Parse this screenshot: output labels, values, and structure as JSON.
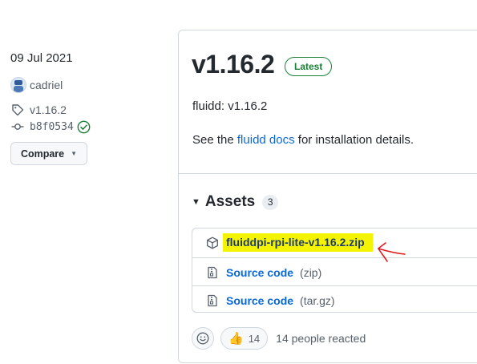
{
  "sidebar": {
    "date": "09 Jul 2021",
    "author": "cadriel",
    "tag": "v1.16.2",
    "commit": "b8f0534",
    "compare_label": "Compare"
  },
  "release": {
    "version": "v1.16.2",
    "badge": "Latest",
    "name": "fluidd: v1.16.2",
    "desc_prefix": "See the ",
    "desc_link": "fluidd docs",
    "desc_suffix": " for installation details."
  },
  "assets": {
    "title": "Assets",
    "count": "3",
    "items": [
      {
        "name": "fluiddpi-rpi-lite-v1.16.2.zip",
        "format": "",
        "icon": "package-icon",
        "highlighted": true
      },
      {
        "name": "Source code",
        "format": "(zip)",
        "icon": "file-zip-icon"
      },
      {
        "name": "Source code",
        "format": "(tar.gz)",
        "icon": "file-zip-icon"
      }
    ]
  },
  "reactions": {
    "thumbs_count": "14",
    "summary": "14 people reacted"
  },
  "colors": {
    "link": "#0969da",
    "latest_green": "#1a7f37",
    "highlight": "#f4f400",
    "annotation_red": "#e0191d"
  }
}
